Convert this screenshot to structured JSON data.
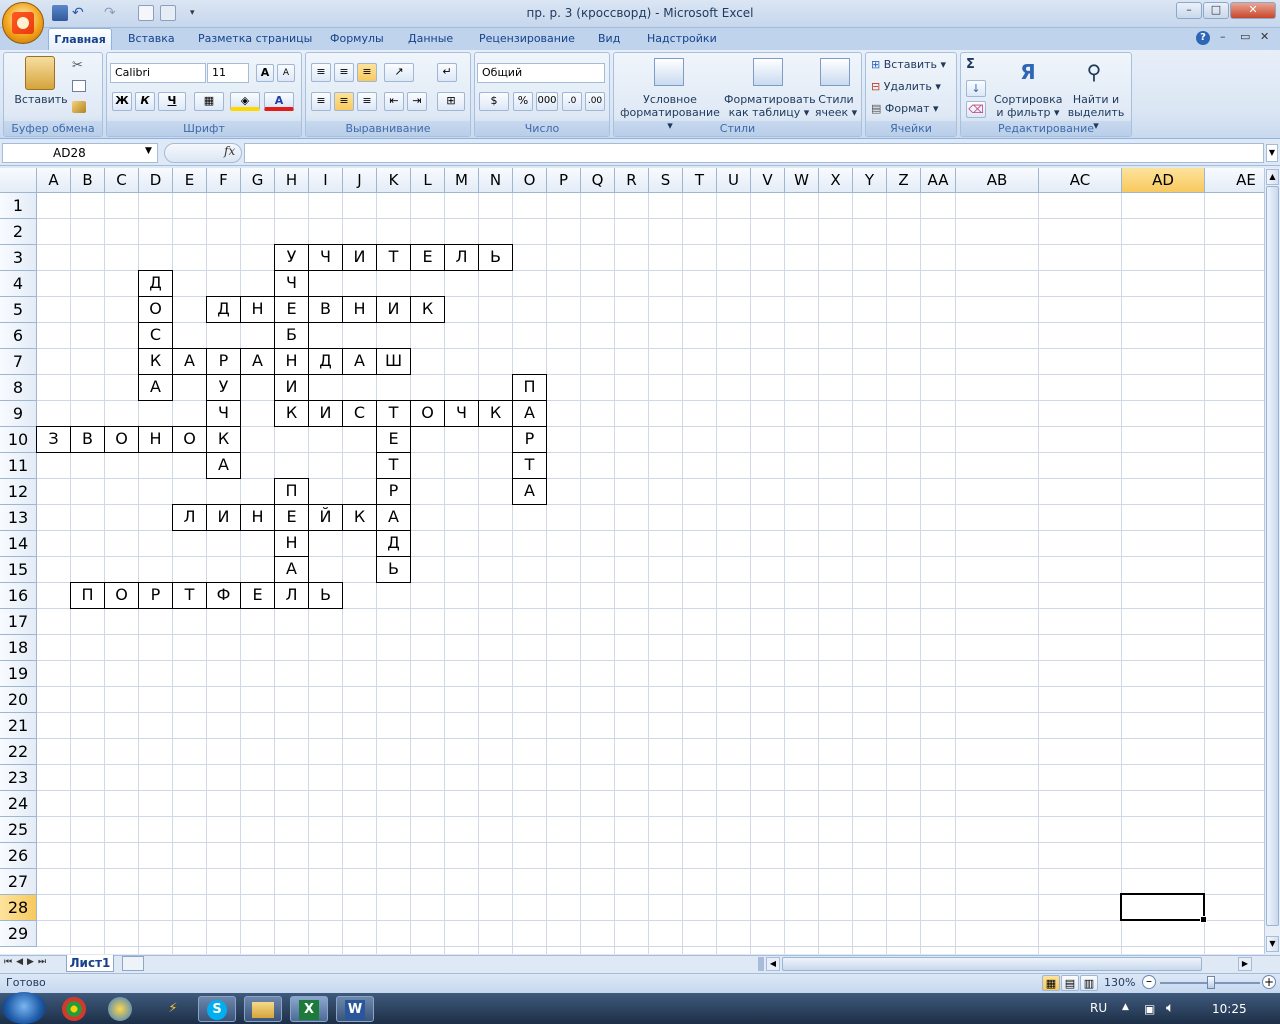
{
  "window": {
    "title": "пр. р. 3 (кроссворд) - Microsoft Excel",
    "buttons": {
      "minimize": "–",
      "maximize": "□",
      "close": "✕"
    }
  },
  "ribbon_tabs": [
    "Главная",
    "Вставка",
    "Разметка страницы",
    "Формулы",
    "Данные",
    "Рецензирование",
    "Вид",
    "Надстройки"
  ],
  "active_tab": "Главная",
  "clipboard": {
    "paste": "Вставить",
    "label": "Буфер обмена"
  },
  "font": {
    "name": "Calibri",
    "size": "11",
    "bold": "Ж",
    "italic": "К",
    "underline": "Ч",
    "grow": "A",
    "shrink": "A",
    "color_letter": "A",
    "label": "Шрифт"
  },
  "alignment": {
    "label": "Выравнивание"
  },
  "number": {
    "format": "Общий",
    "percent": "%",
    "thousands": "000",
    "label": "Число"
  },
  "styles": {
    "conditional": "Условное\nформатирование",
    "cond_l1": "Условное",
    "cond_l2": "форматирование",
    "table_l1": "Форматировать",
    "table_l2": "как таблицу",
    "cell_l1": "Стили",
    "cell_l2": "ячеек",
    "label": "Стили"
  },
  "cells_group": {
    "insert": "Вставить",
    "delete": "Удалить",
    "format": "Формат",
    "label": "Ячейки"
  },
  "editing": {
    "sigma": "Σ",
    "sort_l1": "Сортировка",
    "sort_l2": "и фильтр",
    "find_l1": "Найти и",
    "find_l2": "выделить",
    "label": "Редактирование"
  },
  "formula_bar": {
    "name_box": "AD28",
    "fx": "fx",
    "value": ""
  },
  "columns": [
    "A",
    "B",
    "C",
    "D",
    "E",
    "F",
    "G",
    "H",
    "I",
    "J",
    "K",
    "L",
    "M",
    "N",
    "O",
    "P",
    "Q",
    "R",
    "S",
    "T",
    "U",
    "V",
    "W",
    "X",
    "Y",
    "Z",
    "AA",
    "AB",
    "AC",
    "AD",
    "AE"
  ],
  "rows": [
    "1",
    "2",
    "3",
    "4",
    "5",
    "6",
    "7",
    "8",
    "9",
    "10",
    "11",
    "12",
    "13",
    "14",
    "15",
    "16",
    "17",
    "18",
    "19",
    "20",
    "21",
    "22",
    "23",
    "24",
    "25",
    "26",
    "27",
    "28",
    "29"
  ],
  "selected": {
    "col": "AD",
    "row": "28"
  },
  "crossword": [
    {
      "r": 3,
      "c": "H",
      "v": "У"
    },
    {
      "r": 3,
      "c": "I",
      "v": "Ч"
    },
    {
      "r": 3,
      "c": "J",
      "v": "И"
    },
    {
      "r": 3,
      "c": "K",
      "v": "Т"
    },
    {
      "r": 3,
      "c": "L",
      "v": "Е"
    },
    {
      "r": 3,
      "c": "M",
      "v": "Л"
    },
    {
      "r": 3,
      "c": "N",
      "v": "Ь"
    },
    {
      "r": 4,
      "c": "D",
      "v": "Д"
    },
    {
      "r": 4,
      "c": "H",
      "v": "Ч"
    },
    {
      "r": 5,
      "c": "D",
      "v": "О"
    },
    {
      "r": 5,
      "c": "F",
      "v": "Д"
    },
    {
      "r": 5,
      "c": "G",
      "v": "Н"
    },
    {
      "r": 5,
      "c": "H",
      "v": "Е"
    },
    {
      "r": 5,
      "c": "I",
      "v": "В"
    },
    {
      "r": 5,
      "c": "J",
      "v": "Н"
    },
    {
      "r": 5,
      "c": "K",
      "v": "И"
    },
    {
      "r": 5,
      "c": "L",
      "v": "К"
    },
    {
      "r": 6,
      "c": "D",
      "v": "С"
    },
    {
      "r": 6,
      "c": "H",
      "v": "Б"
    },
    {
      "r": 7,
      "c": "D",
      "v": "К"
    },
    {
      "r": 7,
      "c": "E",
      "v": "А"
    },
    {
      "r": 7,
      "c": "F",
      "v": "Р"
    },
    {
      "r": 7,
      "c": "G",
      "v": "А"
    },
    {
      "r": 7,
      "c": "H",
      "v": "Н"
    },
    {
      "r": 7,
      "c": "I",
      "v": "Д"
    },
    {
      "r": 7,
      "c": "J",
      "v": "А"
    },
    {
      "r": 7,
      "c": "K",
      "v": "Ш"
    },
    {
      "r": 8,
      "c": "D",
      "v": "А"
    },
    {
      "r": 8,
      "c": "F",
      "v": "У"
    },
    {
      "r": 8,
      "c": "H",
      "v": "И"
    },
    {
      "r": 8,
      "c": "O",
      "v": "П"
    },
    {
      "r": 9,
      "c": "F",
      "v": "Ч"
    },
    {
      "r": 9,
      "c": "H",
      "v": "К"
    },
    {
      "r": 9,
      "c": "I",
      "v": "И"
    },
    {
      "r": 9,
      "c": "J",
      "v": "С"
    },
    {
      "r": 9,
      "c": "K",
      "v": "Т"
    },
    {
      "r": 9,
      "c": "L",
      "v": "О"
    },
    {
      "r": 9,
      "c": "M",
      "v": "Ч"
    },
    {
      "r": 9,
      "c": "N",
      "v": "К"
    },
    {
      "r": 9,
      "c": "O",
      "v": "А"
    },
    {
      "r": 10,
      "c": "A",
      "v": "З"
    },
    {
      "r": 10,
      "c": "B",
      "v": "В"
    },
    {
      "r": 10,
      "c": "C",
      "v": "О"
    },
    {
      "r": 10,
      "c": "D",
      "v": "Н"
    },
    {
      "r": 10,
      "c": "E",
      "v": "О"
    },
    {
      "r": 10,
      "c": "F",
      "v": "К"
    },
    {
      "r": 10,
      "c": "K",
      "v": "Е"
    },
    {
      "r": 10,
      "c": "O",
      "v": "Р"
    },
    {
      "r": 11,
      "c": "F",
      "v": "А"
    },
    {
      "r": 11,
      "c": "K",
      "v": "Т"
    },
    {
      "r": 11,
      "c": "O",
      "v": "Т"
    },
    {
      "r": 12,
      "c": "H",
      "v": "П"
    },
    {
      "r": 12,
      "c": "K",
      "v": "Р"
    },
    {
      "r": 12,
      "c": "O",
      "v": "А"
    },
    {
      "r": 13,
      "c": "E",
      "v": "Л"
    },
    {
      "r": 13,
      "c": "F",
      "v": "И"
    },
    {
      "r": 13,
      "c": "G",
      "v": "Н"
    },
    {
      "r": 13,
      "c": "H",
      "v": "Е"
    },
    {
      "r": 13,
      "c": "I",
      "v": "Й"
    },
    {
      "r": 13,
      "c": "J",
      "v": "К"
    },
    {
      "r": 13,
      "c": "K",
      "v": "А"
    },
    {
      "r": 14,
      "c": "H",
      "v": "Н"
    },
    {
      "r": 14,
      "c": "K",
      "v": "Д"
    },
    {
      "r": 15,
      "c": "H",
      "v": "А"
    },
    {
      "r": 15,
      "c": "K",
      "v": "Ь"
    },
    {
      "r": 16,
      "c": "B",
      "v": "П"
    },
    {
      "r": 16,
      "c": "C",
      "v": "О"
    },
    {
      "r": 16,
      "c": "D",
      "v": "Р"
    },
    {
      "r": 16,
      "c": "E",
      "v": "Т"
    },
    {
      "r": 16,
      "c": "F",
      "v": "Ф"
    },
    {
      "r": 16,
      "c": "G",
      "v": "Е"
    },
    {
      "r": 16,
      "c": "H",
      "v": "Л"
    },
    {
      "r": 16,
      "c": "I",
      "v": "Ь"
    }
  ],
  "sheet_tab": "Лист1",
  "status": {
    "ready": "Готово",
    "zoom": "130%"
  },
  "taskbar": {
    "lang": "RU",
    "time": "10:25"
  }
}
